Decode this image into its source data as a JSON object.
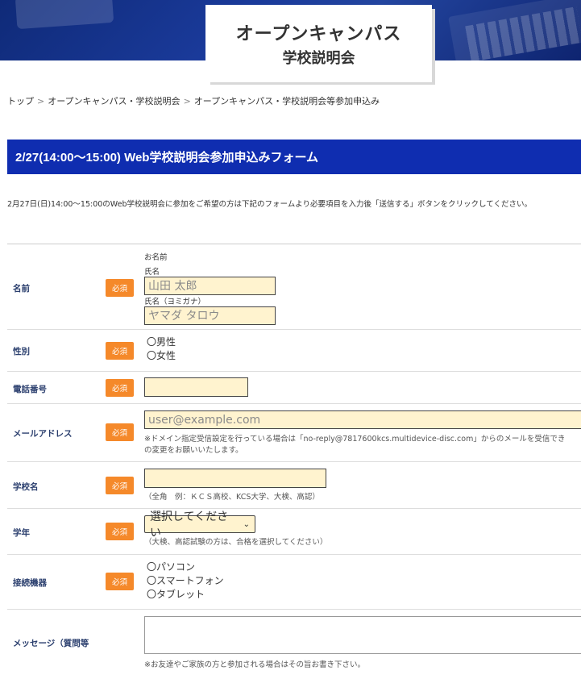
{
  "header": {
    "title_line1": "オープンキャンパス",
    "title_line2": "学校説明会"
  },
  "breadcrumb": [
    "トップ",
    "オープンキャンパス・学校説明会",
    "オープンキャンパス・学校説明会等参加申込み"
  ],
  "form_title": "2/27(14:00～15:00) Web学校説明会参加申込みフォーム",
  "intro_text": "2月27日(日)14:00～15:00のWeb学校説明会に参加をご希望の方は下記のフォームより必要項目を入力後「送信する」ボタンをクリックしてください。",
  "required_label": "必須",
  "fields": {
    "name": {
      "label": "名前",
      "group_label": "お名前",
      "name_label": "氏名",
      "name_placeholder": "山田 太郎",
      "kana_label": "氏名（ヨミガナ）",
      "kana_placeholder": "ヤマダ タロウ"
    },
    "gender": {
      "label": "性別",
      "options": [
        "〇男性",
        "〇女性"
      ]
    },
    "phone": {
      "label": "電話番号",
      "value": ""
    },
    "email": {
      "label": "メールアドレス",
      "placeholder": "user@example.com",
      "note_line1": "※ドメイン指定受信設定を行っている場合は「no-reply@7817600kcs.multidevice-disc.com」からのメールを受信でき",
      "note_line2": "の変更をお願いいたします。"
    },
    "school": {
      "label": "学校名",
      "note": "（全角　例：ＫＣＳ高校、KCS大学、大検、高認）"
    },
    "grade": {
      "label": "学年",
      "selected": "選択してください",
      "note": "（大検、高認試験の方は、合格を選択してください）"
    },
    "device": {
      "label": "接続機器",
      "options": [
        "〇パソコン",
        "〇スマートフォン",
        "〇タブレット"
      ]
    },
    "message": {
      "label": "メッセージ（質問等",
      "note": "※お友達やご家族の方と参加される場合はその旨お書き下さい。"
    }
  },
  "colors": {
    "header_blue": "#0f2db0",
    "required_orange": "#f5892a",
    "input_bg": "#fff3cf"
  }
}
